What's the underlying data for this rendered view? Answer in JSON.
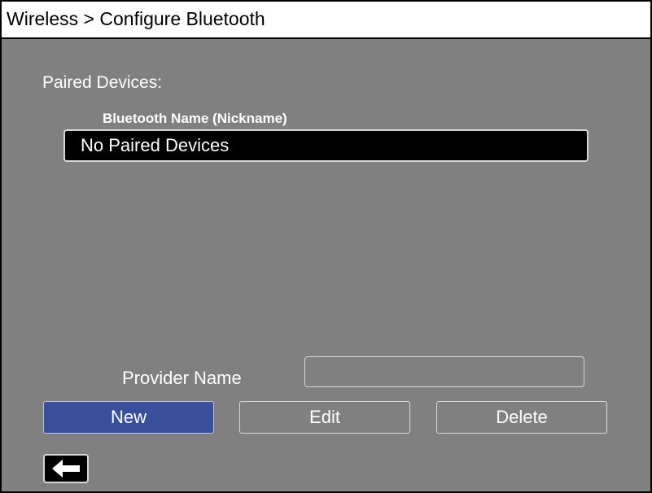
{
  "header": {
    "title": "Wireless > Configure Bluetooth"
  },
  "paired": {
    "section_label": "Paired Devices:",
    "column_header": "Bluetooth Name (Nickname)",
    "rows": [
      "No Paired Devices"
    ]
  },
  "provider": {
    "label": "Provider Name",
    "value": "",
    "placeholder": ""
  },
  "buttons": {
    "new_label": "New",
    "edit_label": "Edit",
    "delete_label": "Delete"
  },
  "footer": {
    "back_icon": "left-arrow-icon"
  },
  "colors": {
    "background": "#808080",
    "title_bar": "#ffffff",
    "selected_button": "#3a4f9c",
    "row_background": "#000000",
    "text": "#ffffff"
  }
}
